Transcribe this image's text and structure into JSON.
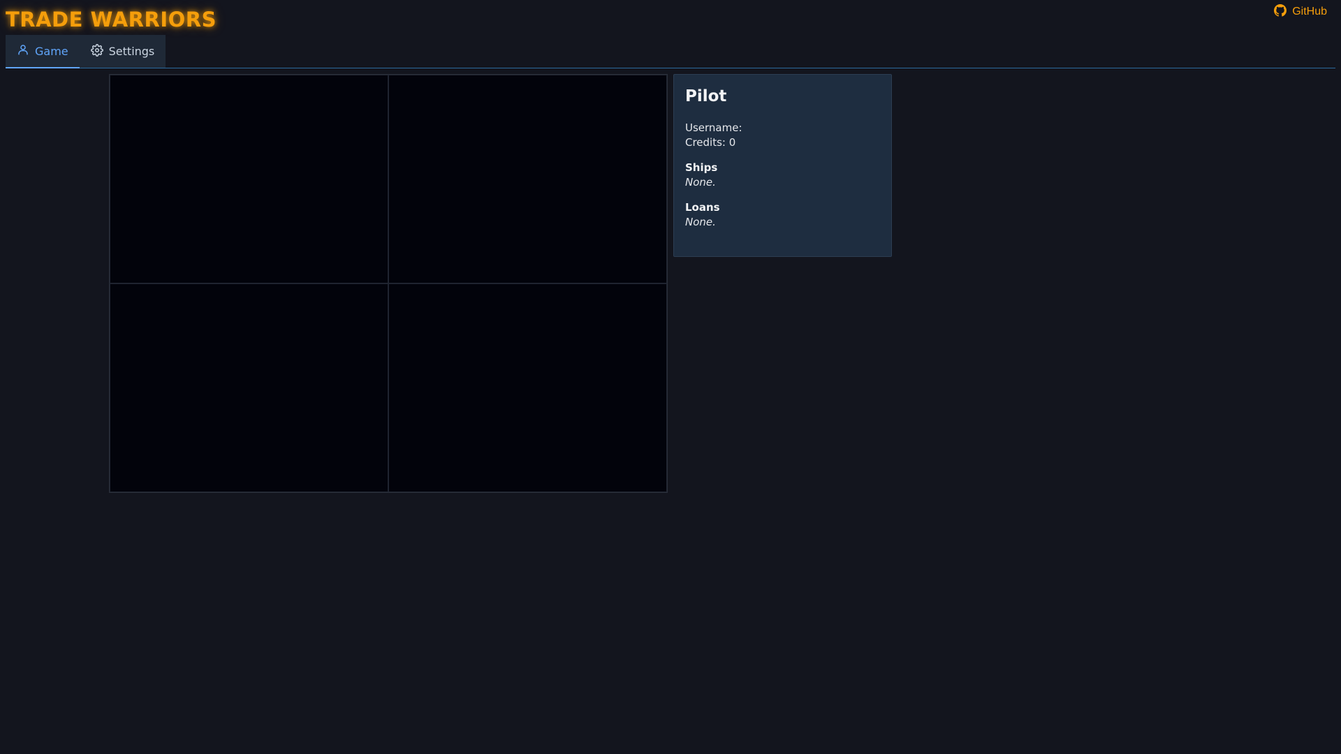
{
  "app": {
    "title": "TRADE WARRIORS",
    "accent_color": "#f59e0b",
    "github_label": "GitHub",
    "github_icon": "github-icon"
  },
  "tabs": [
    {
      "label": "Game",
      "icon": "user-icon",
      "active": true
    },
    {
      "label": "Settings",
      "icon": "gear-icon",
      "active": false
    }
  ],
  "pilot": {
    "title": "Pilot",
    "username_label": "Username:",
    "username_value": "",
    "credits_label": "Credits:",
    "credits_value": "0",
    "ships_heading": "Ships",
    "ships_value": "None.",
    "loans_heading": "Loans",
    "loans_value": "None."
  }
}
